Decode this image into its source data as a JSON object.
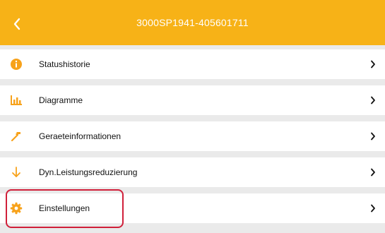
{
  "header": {
    "title": "3000SP1941-405601711",
    "back_icon": "chevron-left-icon",
    "background": "#f7b217"
  },
  "menu": {
    "items": [
      {
        "label": "Statushistorie",
        "icon": "info-icon"
      },
      {
        "label": "Diagramme",
        "icon": "bar-chart-icon"
      },
      {
        "label": "Geraeteinformationen",
        "icon": "hammer-icon"
      },
      {
        "label": "Dyn.Leistungsreduzierung",
        "icon": "arrow-down-icon"
      },
      {
        "label": "Einstellungen",
        "icon": "gear-icon"
      }
    ],
    "accent": "#f7a21b",
    "highlight_color": "#d0203a"
  }
}
